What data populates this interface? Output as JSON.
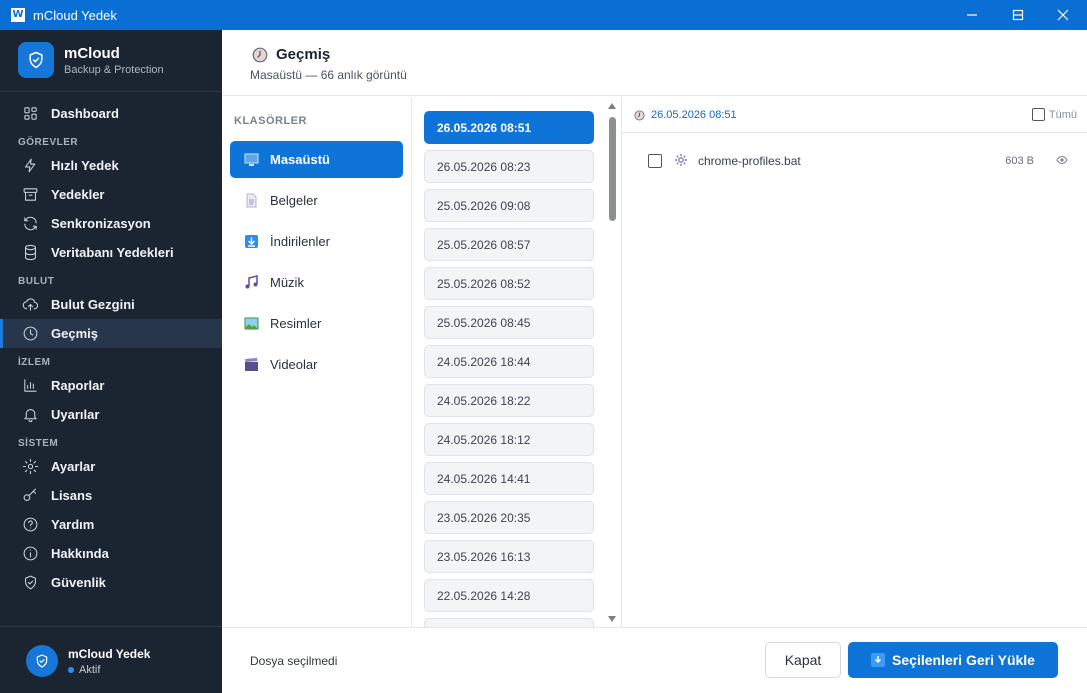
{
  "window": {
    "title": "mCloud Yedek",
    "app_icon": "W"
  },
  "brand": {
    "name": "mCloud",
    "subtitle": "Backup & Protection"
  },
  "sidebar": {
    "items": [
      {
        "label": "Dashboard",
        "icon": "grid-icon"
      },
      {
        "label": "Hızlı Yedek",
        "icon": "lightning-icon"
      },
      {
        "label": "Yedekler",
        "icon": "archive-icon"
      },
      {
        "label": "Senkronizasyon",
        "icon": "sync-icon"
      },
      {
        "label": "Veritabanı Yedekleri",
        "icon": "database-icon"
      },
      {
        "label": "Bulut Gezgini",
        "icon": "cloud-upload-icon"
      },
      {
        "label": "Geçmiş",
        "icon": "clock-icon"
      },
      {
        "label": "Raporlar",
        "icon": "bar-chart-icon"
      },
      {
        "label": "Uyarılar",
        "icon": "bell-icon"
      },
      {
        "label": "Ayarlar",
        "icon": "gear-icon"
      },
      {
        "label": "Lisans",
        "icon": "key-icon"
      },
      {
        "label": "Yardım",
        "icon": "help-icon"
      },
      {
        "label": "Hakkında",
        "icon": "info-icon"
      },
      {
        "label": "Güvenlik",
        "icon": "shield-icon"
      }
    ],
    "sections": [
      "GÖREVLER",
      "BULUT",
      "İZLEM",
      "SİSTEM"
    ],
    "active_item": "Geçmiş"
  },
  "user": {
    "name": "mCloud Yedek",
    "status": "Aktif"
  },
  "header": {
    "title": "Geçmiş",
    "subtitle": "Masaüstü — 66 anlık görüntü"
  },
  "folders": {
    "label": "KLASÖRLER",
    "items": [
      "Masaüstü",
      "Belgeler",
      "İndirilenler",
      "Müzik",
      "Resimler",
      "Videolar"
    ],
    "active": "Masaüstü"
  },
  "snapshots": {
    "items": [
      "26.05.2026 08:51",
      "26.05.2026 08:23",
      "25.05.2026 09:08",
      "25.05.2026 08:57",
      "25.05.2026 08:52",
      "25.05.2026 08:45",
      "24.05.2026 18:44",
      "24.05.2026 18:22",
      "24.05.2026 18:12",
      "24.05.2026 14:41",
      "23.05.2026 20:35",
      "23.05.2026 16:13",
      "22.05.2026 14:28"
    ],
    "active": "26.05.2026 08:51"
  },
  "files": {
    "selected_date": "26.05.2026 08:51",
    "select_all_label": "Tümü",
    "rows": [
      {
        "name": "chrome-profiles.bat",
        "size": "603 B"
      }
    ]
  },
  "footer": {
    "status": "Dosya seçilmedi",
    "close_label": "Kapat",
    "restore_label": "Seçilenleri Geri Yükle"
  },
  "colors": {
    "accent": "#0f74d8",
    "sidebar_bg": "#1b2431",
    "titlebar": "#0a6fd4"
  }
}
